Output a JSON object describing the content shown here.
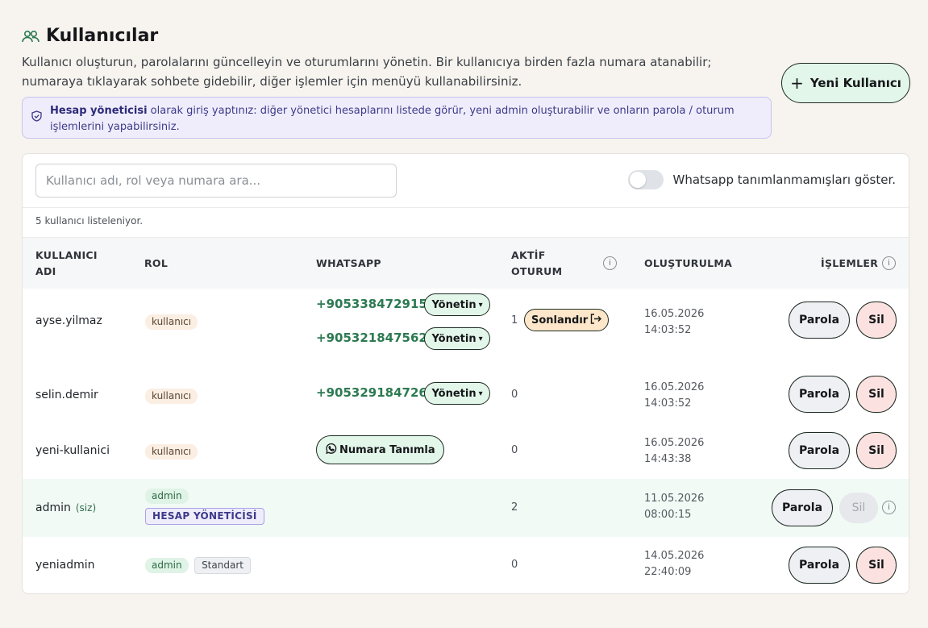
{
  "page": {
    "title": "Kullanıcılar",
    "description": "Kullanıcı oluşturun, parolalarını güncelleyin ve oturumlarını yönetin. Bir kullanıcıya birden fazla numara atanabilir; numaraya tıklayarak sohbete gidebilir, diğer işlemler için menüyü kullanabilirsiniz.",
    "new_user_label": "Yeni Kullanıcı"
  },
  "notice": {
    "bold": "Hesap yöneticisi",
    "text": " olarak giriş yaptınız: diğer yönetici hesaplarını listede görür, yeni admin oluşturabilir ve onların parola / oturum işlemlerini yapabilirsiniz."
  },
  "toolbar": {
    "search_placeholder": "Kullanıcı adı, rol veya numara ara...",
    "toggle_label": "Whatsapp tanımlanmamışları göster.",
    "toggle_on": false,
    "count_text": "5 kullanıcı listeleniyor."
  },
  "columns": {
    "username_1": "KULLANICI",
    "username_2": "ADI",
    "role": "ROL",
    "whatsapp": "WHATSAPP",
    "active_1": "AKTİF",
    "active_2": "OTURUM",
    "created": "OLUŞTURULMA",
    "actions": "İŞLEMLER"
  },
  "common": {
    "manage_label": "Yönetin",
    "caret": "▾",
    "end_session_label": "Sonlandır",
    "define_number_label": "Numara Tanımla",
    "password_label": "Parola",
    "delete_label": "Sil",
    "you_label": "(siz)",
    "info_glyph": "i"
  },
  "users": [
    {
      "username": "ayse.yilmaz",
      "role": "kullanıcı",
      "phones": [
        "+905338472915",
        "+905321847562"
      ],
      "sessions": "1",
      "date": "16.05.2026",
      "time": "14:03:52"
    },
    {
      "username": "selin.demir",
      "role": "kullanıcı",
      "phones": [
        "+905329184726"
      ],
      "sessions": "0",
      "date": "16.05.2026",
      "time": "14:03:52"
    },
    {
      "username": "yeni-kullanici",
      "role": "kullanıcı",
      "phones": [],
      "sessions": "0",
      "date": "16.05.2026",
      "time": "14:43:38"
    },
    {
      "username": "admin",
      "role": "admin",
      "role_extra": "HESAP YÖNETİCİSİ",
      "phones": [],
      "sessions": "2",
      "date": "11.05.2026",
      "time": "08:00:15"
    },
    {
      "username": "yeniadmin",
      "role": "admin",
      "role_extra": "Standart",
      "phones": [],
      "sessions": "0",
      "date": "14.05.2026",
      "time": "22:40:09"
    }
  ],
  "colors": {
    "accent_green": "#2c7a51",
    "button_green_bg": "#e3f6ea",
    "danger_bg": "#fbe2e0",
    "notice_bg": "#efedfb"
  },
  "icons": {
    "title": "users-icon",
    "add": "plus-icon",
    "notice": "shield-check-icon",
    "whatsapp": "whatsapp-icon",
    "end_session": "logout-icon",
    "info": "info-icon"
  }
}
